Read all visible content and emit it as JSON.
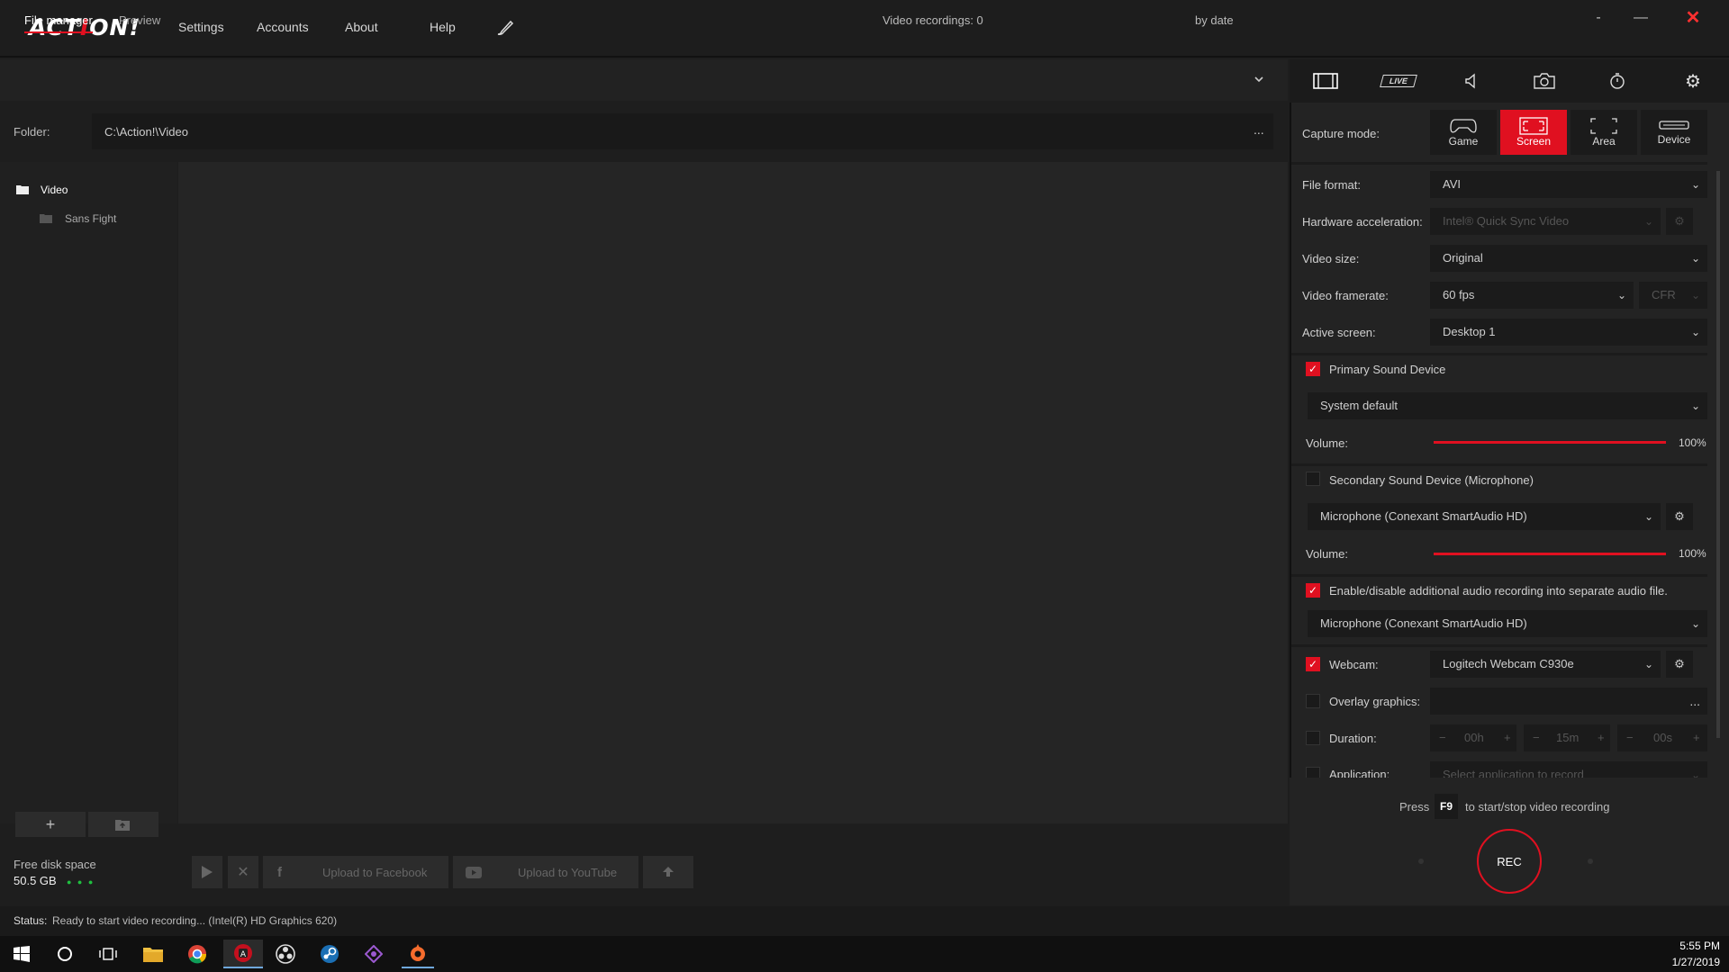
{
  "app": {
    "logo_a": "ACT",
    "logo_b": "!",
    "logo_c": "ON!"
  },
  "menu": [
    "Settings",
    "Accounts",
    "About",
    "Help"
  ],
  "window": {
    "minimize": "-",
    "maximize": "—",
    "close": "✕"
  },
  "file_manager": {
    "tab_file_manager": "File manager",
    "tab_preview": "Preview",
    "recordings": "Video recordings: 0",
    "sort": "by date",
    "folder_label": "Folder:",
    "folder_path": "C:\\Action!\\Video",
    "folder_more": "...",
    "tree": [
      {
        "label": "Video"
      },
      {
        "label": "Sans Fight"
      }
    ],
    "free_space_label": "Free disk space",
    "free_space_value": "50.5 GB",
    "upload_facebook": "Upload to Facebook",
    "upload_youtube": "Upload to YouTube"
  },
  "status": {
    "label": "Status:",
    "text": "Ready to start video recording...  (Intel(R) HD Graphics 620)"
  },
  "right": {
    "live_label": "LIVE",
    "capture_mode_label": "Capture mode:",
    "capture_modes": [
      "Game",
      "Screen",
      "Area",
      "Device"
    ],
    "file_format_label": "File format:",
    "file_format": "AVI",
    "hw_accel_label": "Hardware acceleration:",
    "hw_accel": "Intel® Quick Sync Video",
    "video_size_label": "Video size:",
    "video_size": "Original",
    "framerate_label": "Video framerate:",
    "framerate": "60 fps",
    "framerate_mode": "CFR",
    "active_screen_label": "Active screen:",
    "active_screen": "Desktop 1",
    "primary_sound_label": "Primary Sound Device",
    "primary_sound": "System default",
    "volume_label": "Volume:",
    "primary_volume": "100%",
    "primary_volume_level": 1.0,
    "secondary_sound_label": "Secondary Sound Device (Microphone)",
    "secondary_sound": "Microphone (Conexant SmartAudio HD)",
    "secondary_volume": "100%",
    "secondary_volume_level": 1.0,
    "additional_audio_label": "Enable/disable additional audio recording into separate audio file.",
    "additional_audio": "Microphone (Conexant SmartAudio HD)",
    "webcam_label": "Webcam:",
    "webcam": "Logitech Webcam C930e",
    "overlay_label": "Overlay graphics:",
    "overlay_more": "...",
    "duration_label": "Duration:",
    "duration_h": "00h",
    "duration_m": "15m",
    "duration_s": "00s",
    "application_label": "Application:",
    "application_placeholder": "Select application to record",
    "press": "Press",
    "hotkey": "F9",
    "hotkey_hint": "to start/stop video recording",
    "rec": "REC"
  },
  "clock": {
    "time": "5:55 PM",
    "date": "1/27/2019"
  },
  "colors": {
    "accent": "#e01020",
    "background": "#1e1e1e"
  }
}
